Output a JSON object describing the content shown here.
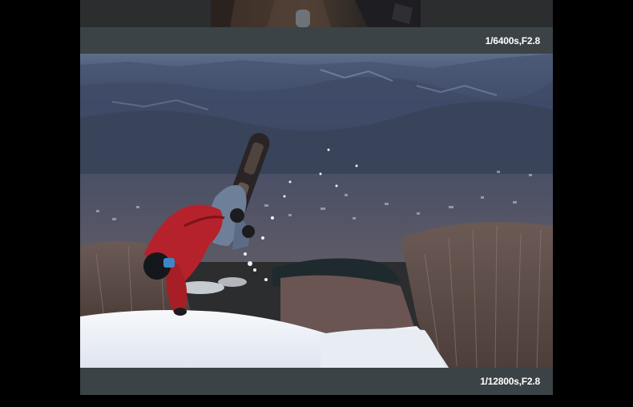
{
  "photos": {
    "top": {
      "caption": "1/6400s,F2.8"
    },
    "main": {
      "caption": "1/12800s,F2.8"
    }
  },
  "colors": {
    "background": "#000000",
    "caption_bar": "#3b4346",
    "caption_text": "#ffffff",
    "jacket": "#b5222b",
    "sky": "#5b6a86",
    "snow": "#f3f5f9"
  }
}
